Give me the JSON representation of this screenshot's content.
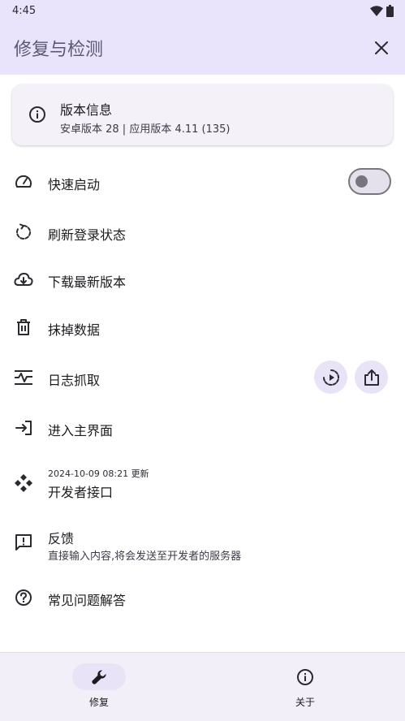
{
  "status_bar": {
    "time": "4:45"
  },
  "app_bar": {
    "title": "修复与检测"
  },
  "version_card": {
    "title": "版本信息",
    "subtitle": "安卓版本 28 | 应用版本 4.11 (135)"
  },
  "items": {
    "quick_start": {
      "label": "快速启动",
      "toggle_on": false
    },
    "refresh_login": {
      "label": "刷新登录状态"
    },
    "download_latest": {
      "label": "下载最新版本"
    },
    "wipe_data": {
      "label": "抹掉数据"
    },
    "log_capture": {
      "label": "日志抓取"
    },
    "enter_main": {
      "label": "进入主界面"
    },
    "developer_api": {
      "updated": "2024-10-09 08:21 更新",
      "label": "开发者接口"
    },
    "feedback": {
      "label": "反馈",
      "description": "直接输入内容,将会发送至开发者的服务器"
    },
    "faq": {
      "label": "常见问题解答"
    }
  },
  "bottom_nav": {
    "repair": "修复",
    "about": "关于"
  },
  "colors": {
    "header_bg": "#e9e3fb",
    "title": "#5b5875",
    "nav_active_pill": "#e8e3f6",
    "icon": "#2b2a31"
  }
}
